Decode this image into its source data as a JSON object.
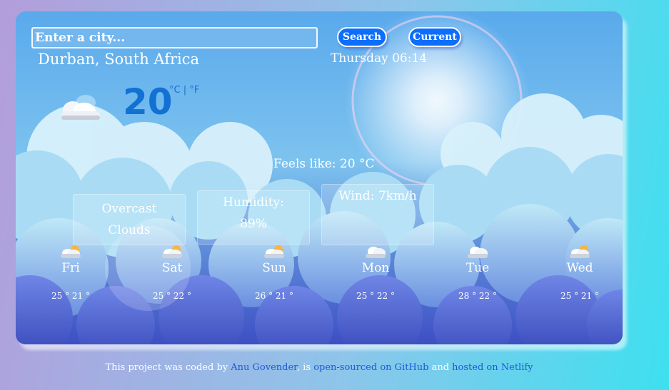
{
  "search": {
    "placeholder": "Enter a city..."
  },
  "buttons": {
    "search_label": "Search",
    "current_label": "Current"
  },
  "city": "Durban, South Africa",
  "datetime": "Thursday 06:14",
  "current": {
    "temperature": "20",
    "units": "°C | °F",
    "icon": "partly-cloudy-icon",
    "feels_like": "Feels like: 20 °C",
    "condition_line1": "Overcast",
    "condition_line2": "Clouds",
    "humidity_label": "Humidity:",
    "humidity_value": "89%",
    "wind": "Wind: 7km/h"
  },
  "forecast": [
    {
      "day": "Fri",
      "range": "25 ° 21 °",
      "icon": "sun-behind-cloud-icon"
    },
    {
      "day": "Sat",
      "range": "25 ° 22 °",
      "icon": "sun-behind-cloud-icon"
    },
    {
      "day": "Sun",
      "range": "26 ° 21 °",
      "icon": "sun-behind-cloud-icon"
    },
    {
      "day": "Mon",
      "range": "25 ° 22 °",
      "icon": "cloud-icon"
    },
    {
      "day": "Tue",
      "range": "28 ° 22 °",
      "icon": "cloud-icon"
    },
    {
      "day": "Wed",
      "range": "25 ° 21 °",
      "icon": "sun-behind-cloud-icon"
    }
  ],
  "footer": {
    "prefix": "This project was coded by ",
    "author": "Anu Govender",
    "mid1": ", is ",
    "source_link": "open-sourced on GitHub",
    "mid2": " and ",
    "host_link": "hosted on Netlify"
  },
  "colors": {
    "accent": "#0d6efd",
    "temperature": "#1272d3",
    "link": "#1a5ad8"
  }
}
